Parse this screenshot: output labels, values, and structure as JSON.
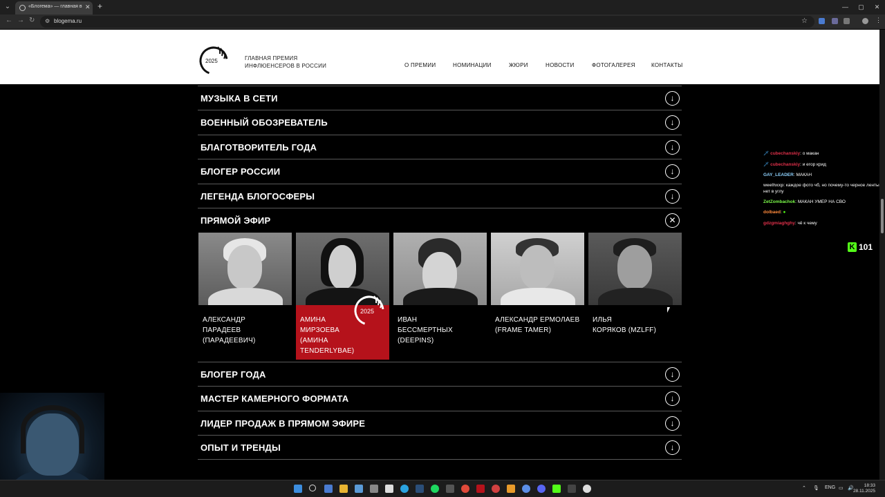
{
  "browser": {
    "tab_title": "«Блогема» — главная в Росси",
    "url": "blogema.ru",
    "new_tab": "+",
    "tab_close": "✕",
    "menu": "⌄",
    "back": "←",
    "forward": "→",
    "reload": "↻",
    "star": "☆",
    "win_min": "—",
    "win_max": "▢",
    "win_close": "✕"
  },
  "site": {
    "logo_year": "2025",
    "tagline_line1": "ГЛАВНАЯ ПРЕМИЯ",
    "tagline_line2": "ИНФЛЮЕНСЕРОВ В РОССИИ",
    "nav": [
      "О ПРЕМИИ",
      "НОМИНАЦИИ",
      "ЖЮРИ",
      "НОВОСТИ",
      "ФОТОГАЛЕРЕЯ",
      "КОНТАКТЫ"
    ]
  },
  "categories_top": [
    {
      "label": "МУЗЫКА В СЕТИ",
      "icon": "arrow-down-circle-icon"
    },
    {
      "label": "ВОЕННЫЙ ОБОЗРЕВАТЕЛЬ",
      "icon": "arrow-down-circle-icon"
    },
    {
      "label": "БЛАГОТВОРИТЕЛЬ ГОДА",
      "icon": "arrow-down-circle-icon"
    },
    {
      "label": "БЛОГЕР РОССИИ",
      "icon": "arrow-down-circle-icon"
    },
    {
      "label": "ЛЕГЕНДА БЛОГОСФЕРЫ",
      "icon": "arrow-down-circle-icon"
    }
  ],
  "open_category": {
    "label": "ПРЯМОЙ ЭФИР",
    "icon": "close-circle-icon"
  },
  "nominees": [
    {
      "name_lines": [
        "АЛЕКСАНДР",
        "ПАРАДЕЕВ",
        "(ПАРАДЕЕВИЧ)"
      ],
      "winner": false
    },
    {
      "name_lines": [
        "АМИНА",
        "МИРЗОЕВА",
        "(АМИНА",
        "TENDERLYBAE)"
      ],
      "winner": true
    },
    {
      "name_lines": [
        "ИВАН",
        "БЕССМЕРТНЫХ",
        "(DEEPINS)"
      ],
      "winner": false
    },
    {
      "name_lines": [
        "АЛЕКСАНДР ЕРМОЛАЕВ",
        "(FRAME TAMER)"
      ],
      "winner": false
    },
    {
      "name_lines": [
        "ИЛЬЯ",
        "КОРЯКОВ (MZLFF)"
      ],
      "winner": false
    }
  ],
  "winner_badge_year": "2025",
  "categories_bottom": [
    {
      "label": "БЛОГЕР ГОДА",
      "icon": "arrow-down-circle-icon"
    },
    {
      "label": "МАСТЕР КАМЕРНОГО ФОРМАТА",
      "icon": "arrow-down-circle-icon"
    },
    {
      "label": "ЛИДЕР ПРОДАЖ В ПРЯМОМ ЭФИРЕ",
      "icon": "arrow-down-circle-icon"
    },
    {
      "label": "ОПЫТ И ТРЕНДЫ",
      "icon": "arrow-down-circle-icon"
    }
  ],
  "icons": {
    "arrow_down": "↓",
    "close": "✕"
  },
  "chat": [
    {
      "user": "cubechanskiy",
      "text": "о макан",
      "color": "#e0304a",
      "wrap": false
    },
    {
      "user": "cubechanskiy",
      "text": "и егор крид",
      "color": "#e0304a",
      "wrap": false
    },
    {
      "user": "GAY_LEADER",
      "text": "МАКАН",
      "color": "#8fd3ff",
      "wrap": false
    },
    {
      "user": "weelhxxp",
      "text": "каждое фото чб, но почему-то черное ленты нет в углу",
      "color": "#c8c8c8",
      "wrap": true
    },
    {
      "user": "ZetZombachok",
      "text": "МАКАН УМЕР НА СВО",
      "color": "#7cfc4a",
      "wrap": false
    },
    {
      "user": "dolbaed",
      "text": "",
      "color": "#ff8a3c",
      "wrap": false
    },
    {
      "user": "gdzgmiaghghy",
      "text": "чё к чему",
      "color": "#e0304a",
      "wrap": false
    }
  ],
  "kick": {
    "logo": "K",
    "viewers": "101"
  },
  "taskbar": {
    "lang": "ENG",
    "time": "18:33",
    "date": "28.11.2025"
  },
  "colors": {
    "winner_red": "#b5121b",
    "kick_green": "#53fc18"
  }
}
